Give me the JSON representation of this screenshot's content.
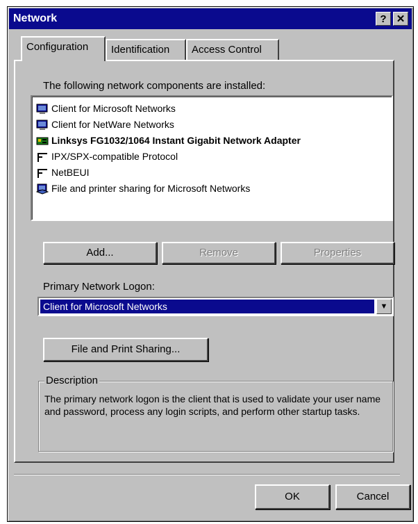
{
  "window": {
    "title": "Network",
    "help_button": "?",
    "close_button": "✕"
  },
  "tabs": [
    {
      "label": "Configuration"
    },
    {
      "label": "Identification"
    },
    {
      "label": "Access Control"
    }
  ],
  "components": {
    "label": "The following network components are installed:",
    "items": [
      {
        "label": "Client for Microsoft Networks",
        "icon": "network-client-icon"
      },
      {
        "label": "Client for NetWare Networks",
        "icon": "network-client-icon"
      },
      {
        "label": "Linksys FG1032/1064 Instant Gigabit Network Adapter",
        "icon": "network-adapter-icon"
      },
      {
        "label": "IPX/SPX-compatible Protocol",
        "icon": "protocol-icon"
      },
      {
        "label": "NetBEUI",
        "icon": "protocol-icon"
      },
      {
        "label": "File and printer sharing for Microsoft Networks",
        "icon": "file-sharing-icon"
      }
    ]
  },
  "buttons": {
    "add": "Add...",
    "remove": "Remove",
    "properties": "Properties",
    "file_print_sharing": "File and Print Sharing...",
    "ok": "OK",
    "cancel": "Cancel"
  },
  "logon": {
    "label": "Primary Network Logon:",
    "selected": "Client for Microsoft Networks"
  },
  "description": {
    "legend": "Description",
    "text": "The primary network logon is the client that is used to validate your user name and password, process any login scripts, and perform other startup tasks."
  },
  "colors": {
    "titlebar": "#0a0a8e",
    "face": "#c0c0c0",
    "selection": "#0a0a8e"
  }
}
